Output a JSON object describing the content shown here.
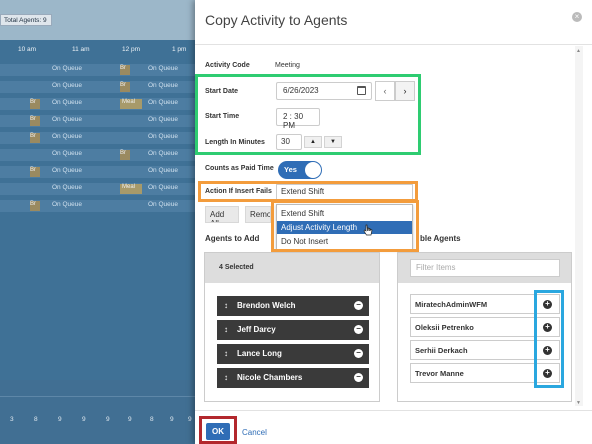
{
  "background": {
    "total_agents": "Total Agents: 9",
    "hours": [
      "10 am",
      "11 am",
      "12 pm",
      "1 pm"
    ],
    "on_queue": "On Queue",
    "break_abbr": "Br",
    "meal": "Meal",
    "bottom_numbers": [
      "3",
      "8",
      "9",
      "9",
      "9",
      "9",
      "8",
      "9",
      "9"
    ]
  },
  "modal": {
    "title": "Copy Activity to Agents",
    "activity_code_label": "Activity Code",
    "activity_code_value": "Meeting",
    "start_date_label": "Start Date",
    "start_date_value": "6/26/2023",
    "start_time_label": "Start Time",
    "start_time_value": "2 : 30  PM",
    "length_label": "Length In Minutes",
    "length_value": "30",
    "paid_label": "Counts as Paid Time",
    "paid_value": "Yes",
    "insert_fail_label": "Action If Insert Fails",
    "insert_fail_value": "Extend Shift",
    "insert_fail_options": [
      "Extend Shift",
      "Adjust Activity Length",
      "Do Not Insert"
    ],
    "add_all_label": "Add All",
    "remove_label": "Remo",
    "agents_to_add_label": "Agents to Add",
    "available_label": "ble Agents",
    "selected_count": "4 Selected",
    "filter_placeholder": "Filter Items",
    "selected_agents": [
      "Brendon Welch",
      "Jeff Darcy",
      "Lance Long",
      "Nicole Chambers"
    ],
    "available_agents": [
      "MiratechAdminWFM",
      "Oleksii Petrenko",
      "Serhii Derkach",
      "Trevor Manne"
    ],
    "ok_label": "OK",
    "cancel_label": "Cancel"
  },
  "icons": {
    "close": "close-icon",
    "calendar": "calendar-icon",
    "prev": "chevron-left-icon",
    "next": "chevron-right-icon",
    "up": "caret-up-icon",
    "down": "caret-down-icon",
    "grip": "drag-handle-icon",
    "minus": "minus-circle-icon",
    "plus": "plus-circle-icon"
  },
  "colors": {
    "accent": "#2f6db6",
    "highlight_green": "#2ecc71",
    "highlight_orange": "#f39c3c",
    "highlight_blue": "#2aa7df",
    "highlight_red": "#b3282d"
  }
}
